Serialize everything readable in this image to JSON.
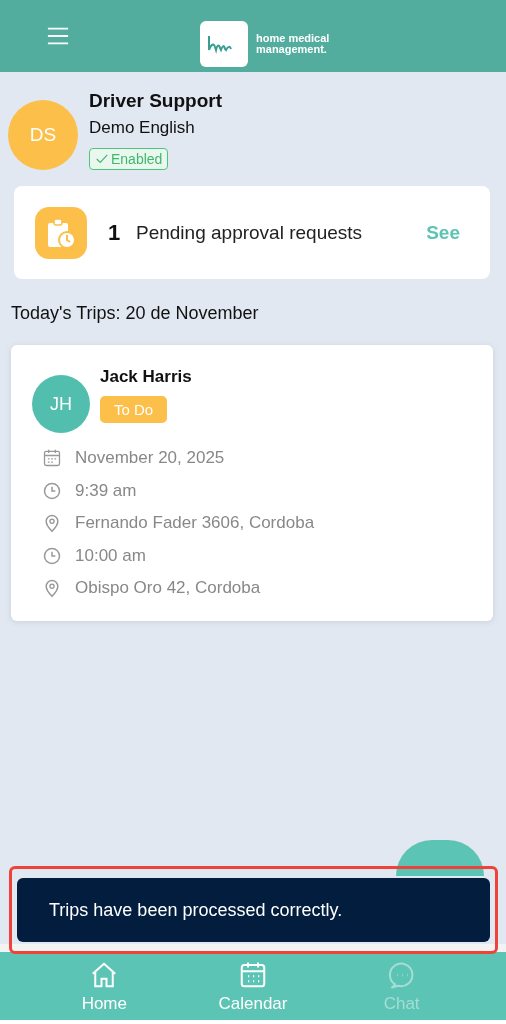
{
  "header": {
    "logo_text": "home medical management."
  },
  "profile": {
    "initials": "DS",
    "name": "Driver Support",
    "subtitle": "Demo English",
    "status": {
      "label": "Enabled",
      "checked": true
    }
  },
  "pending": {
    "count": "1",
    "label": "Pending approval requests",
    "action": "See"
  },
  "trips_title": "Today's Trips: 20 de November",
  "trips": [
    {
      "initials": "JH",
      "name": "Jack Harris",
      "status": "To Do",
      "color": "#fbbf4a",
      "details": [
        {
          "kind": "date",
          "text": "November 20, 2025"
        },
        {
          "kind": "time",
          "text": "9:39 am"
        },
        {
          "kind": "place",
          "text": "Fernando Fader 3606, Cordoba"
        },
        {
          "kind": "time",
          "text": "10:00 am"
        },
        {
          "kind": "place",
          "text": "Obispo Oro 42, Cordoba"
        }
      ]
    }
  ],
  "toast": {
    "message": "Trips have been processed correctly.",
    "highlighted": true
  },
  "bottom_nav": [
    {
      "kind": "home",
      "label": "Home",
      "disabled": false
    },
    {
      "kind": "calendar",
      "label": "Calendar",
      "disabled": false
    },
    {
      "kind": "chat",
      "label": "Chat",
      "disabled": true
    }
  ]
}
